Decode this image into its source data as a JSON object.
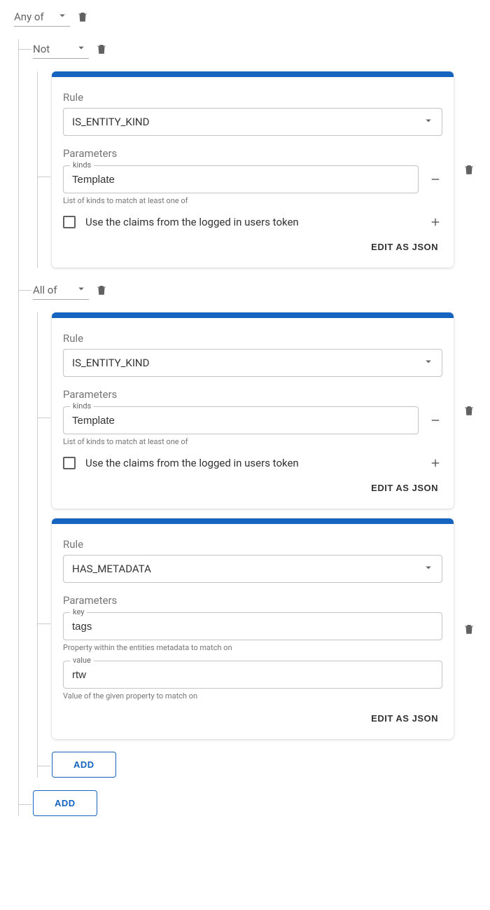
{
  "root": {
    "operator": "Any of",
    "children": [
      {
        "operator": "Not",
        "cards": [
          {
            "rule_label": "Rule",
            "rule_value": "IS_ENTITY_KIND",
            "params_label": "Parameters",
            "fields": [
              {
                "label": "kinds",
                "value": "Template",
                "helper": "List of kinds to match at least one of"
              }
            ],
            "checkbox_label": "Use the claims from the logged in users token",
            "edit_json": "EDIT AS JSON"
          }
        ]
      },
      {
        "operator": "All of",
        "cards": [
          {
            "rule_label": "Rule",
            "rule_value": "IS_ENTITY_KIND",
            "params_label": "Parameters",
            "fields": [
              {
                "label": "kinds",
                "value": "Template",
                "helper": "List of kinds to match at least one of"
              }
            ],
            "checkbox_label": "Use the claims from the logged in users token",
            "edit_json": "EDIT AS JSON"
          },
          {
            "rule_label": "Rule",
            "rule_value": "HAS_METADATA",
            "params_label": "Parameters",
            "fields": [
              {
                "label": "key",
                "value": "tags",
                "helper": "Property within the entities metadata to match on"
              },
              {
                "label": "value",
                "value": "rtw",
                "helper": "Value of the given property to match on"
              }
            ],
            "edit_json": "EDIT AS JSON"
          }
        ],
        "add_label": "ADD"
      }
    ],
    "add_label": "ADD"
  }
}
